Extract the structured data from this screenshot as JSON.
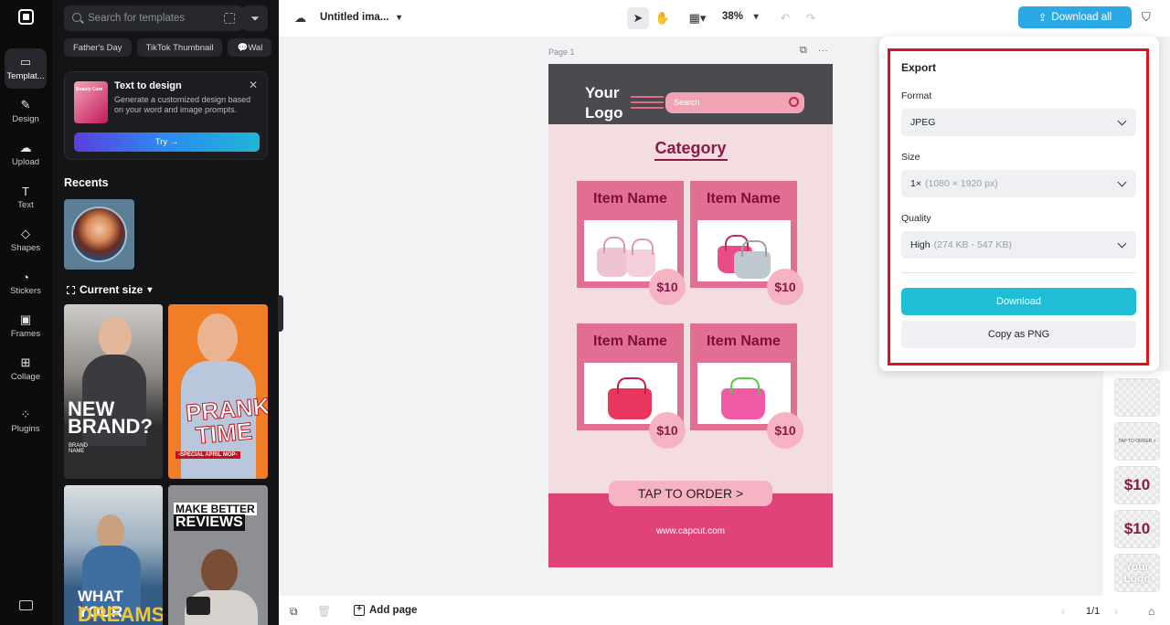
{
  "rail": {
    "items": [
      {
        "label": "Templat..."
      },
      {
        "label": "Design"
      },
      {
        "label": "Upload"
      },
      {
        "label": "Text"
      },
      {
        "label": "Shapes"
      },
      {
        "label": "Stickers"
      },
      {
        "label": "Frames"
      },
      {
        "label": "Collage"
      },
      {
        "label": "Plugins"
      }
    ]
  },
  "panel": {
    "search_placeholder": "Search for templates",
    "chips": [
      "Father's Day",
      "TikTok Thumbnail",
      "💬Wal"
    ],
    "text_to_design": {
      "title": "Text to design",
      "description": "Generate a customized design based on your word and image prompts.",
      "thumb_label": "Beauty Care",
      "try_label": "Try →"
    },
    "recents_label": "Recents",
    "current_size_label": "Current size",
    "templates": [
      {
        "line1": "NEW",
        "line2": "BRAND?",
        "small": "BRAND NAME"
      },
      {
        "line1": "PRANK",
        "line2": "TIME",
        "small": "-SPECIAL APRIL MOP-"
      },
      {
        "line1": "WHAT YOUR",
        "line2": "DREAMS"
      },
      {
        "line1": "MAKE BETTER",
        "line2": "REVIEWS"
      }
    ]
  },
  "topbar": {
    "doc_title": "Untitled ima...",
    "zoom": "38%",
    "download_all": "Download all"
  },
  "canvas": {
    "page_label": "Page 1",
    "design": {
      "logo_line1": "Your",
      "logo_line2": "Logo",
      "search_placeholder": "Search",
      "category": "Category",
      "items": [
        {
          "name": "Item Name",
          "price": "$10"
        },
        {
          "name": "Item Name",
          "price": "$10"
        },
        {
          "name": "Item Name",
          "price": "$10"
        },
        {
          "name": "Item Name",
          "price": "$10"
        }
      ],
      "order_button": "TAP TO ORDER >",
      "url": "www.capcut.com"
    }
  },
  "export": {
    "title": "Export",
    "format_label": "Format",
    "format_value": "JPEG",
    "size_label": "Size",
    "size_value": "1×",
    "size_detail": "(1080 × 1920 px)",
    "quality_label": "Quality",
    "quality_value": "High",
    "quality_detail": "(274 KB - 547 KB)",
    "download_label": "Download",
    "copy_label": "Copy as PNG"
  },
  "layers": {
    "items": [
      "",
      "TAP TO ORDER >",
      "$10",
      "$10",
      "Your Logo"
    ]
  },
  "bottombar": {
    "add_page": "Add page",
    "pager": "1/1"
  },
  "colors": {
    "accent": "#2aa9e6",
    "download_button": "#20bdd7",
    "design_pink": "#e0437a",
    "highlight_border": "#e0101e"
  }
}
